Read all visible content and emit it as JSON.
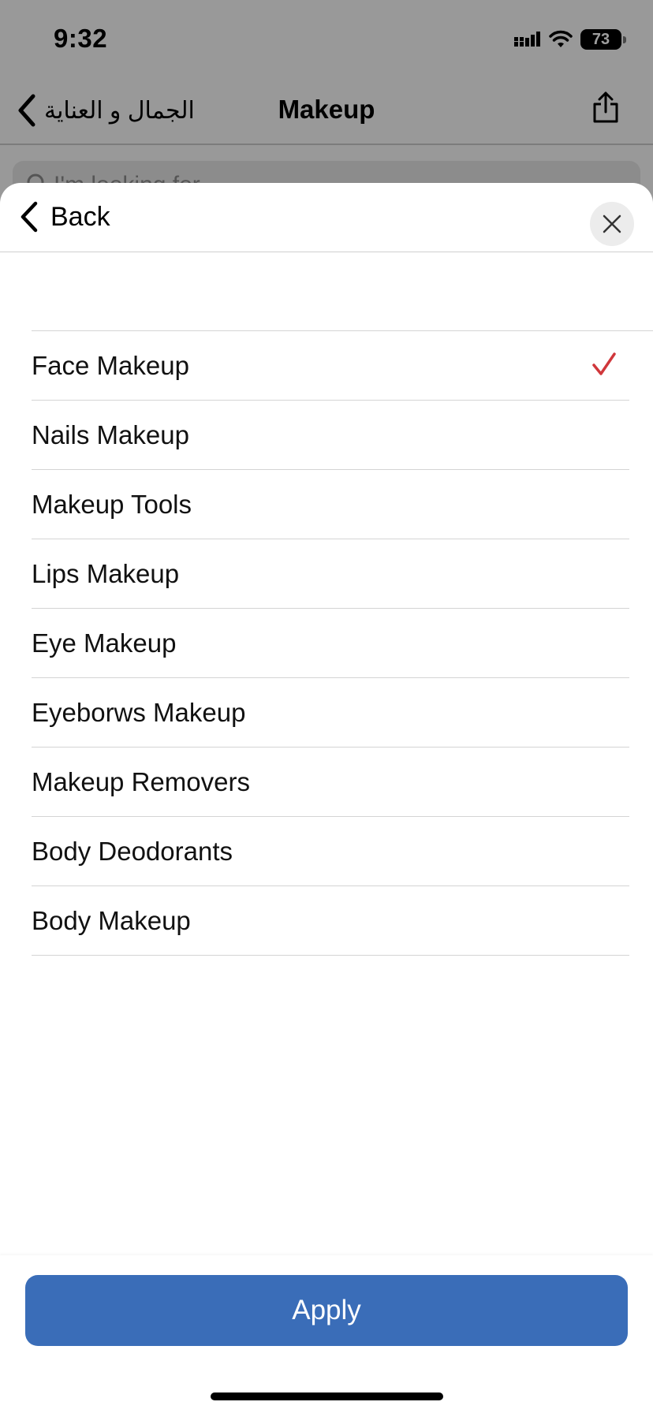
{
  "status_bar": {
    "time": "9:32",
    "battery": "73",
    "icons": [
      "signal-icon",
      "wifi-icon",
      "battery-icon"
    ]
  },
  "nav": {
    "back_label": "الجمال و العناية",
    "title": "Makeup",
    "icons": [
      "chevron-left-icon",
      "share-icon"
    ]
  },
  "search": {
    "placeholder": "I'm looking for..."
  },
  "sheet": {
    "back_label": "Back",
    "close_icon": "close-icon"
  },
  "categories": [
    {
      "label": "Face Makeup",
      "selected": true
    },
    {
      "label": "Nails Makeup",
      "selected": false
    },
    {
      "label": "Makeup Tools",
      "selected": false
    },
    {
      "label": "Lips Makeup",
      "selected": false
    },
    {
      "label": "Eye Makeup",
      "selected": false
    },
    {
      "label": "Eyeborws Makeup",
      "selected": false
    },
    {
      "label": "Makeup Removers",
      "selected": false
    },
    {
      "label": "Body Deodorants",
      "selected": false
    },
    {
      "label": "Body Makeup",
      "selected": false
    }
  ],
  "footer": {
    "apply_label": "Apply"
  },
  "colors": {
    "accent": "#3a6db8",
    "check": "#d0373b",
    "overlay": "rgba(0,0,0,0.38)"
  }
}
